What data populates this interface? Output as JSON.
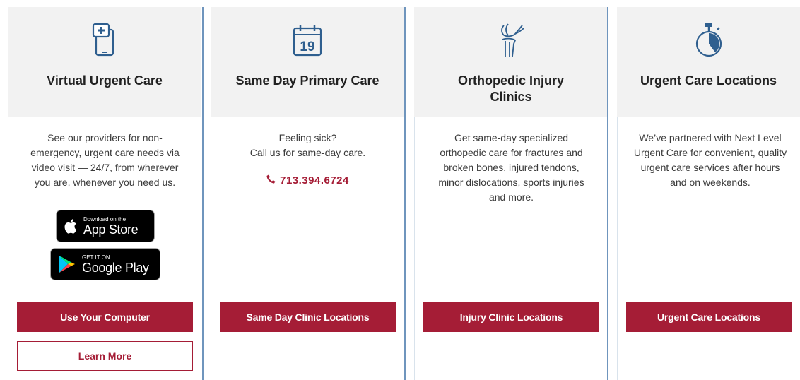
{
  "cards": [
    {
      "title": "Virtual Urgent Care",
      "icon": "phone-medical-icon",
      "description": "See our providers for non-\nemergency, urgent care needs via\nvideo visit — 24/7, from wherever\nyou are, whenever you need us.",
      "app_store": {
        "small": "Download on the",
        "big": "App Store"
      },
      "google_play": {
        "small": "GET IT ON",
        "big": "Google Play"
      },
      "primary_button": "Use Your Computer",
      "secondary_button": "Learn More"
    },
    {
      "title": "Same Day Primary Care",
      "icon": "calendar-icon",
      "icon_text": "19",
      "description": "Feeling sick?\nCall us for same-day care.",
      "phone": "713.394.6724",
      "primary_button": "Same Day Clinic Locations"
    },
    {
      "title": "Orthopedic Injury Clinics",
      "icon": "knee-joint-icon",
      "description": "Get same-day specialized\northopedic care for fractures and\nbroken bones, injured tendons,\nminor dislocations, sports injuries\nand more.",
      "primary_button": "Injury Clinic Locations"
    },
    {
      "title": "Urgent Care Locations",
      "icon": "stopwatch-icon",
      "description": "We’ve partnered with Next Level\nUrgent Care for convenient, quality\nurgent care services after hours\nand on weekends.",
      "primary_button": "Urgent Care Locations"
    }
  ],
  "colors": {
    "accent": "#a51d36",
    "header_bg": "#f2f2f2",
    "divider": "#6f95bd",
    "icon": "#2f5f8f"
  }
}
